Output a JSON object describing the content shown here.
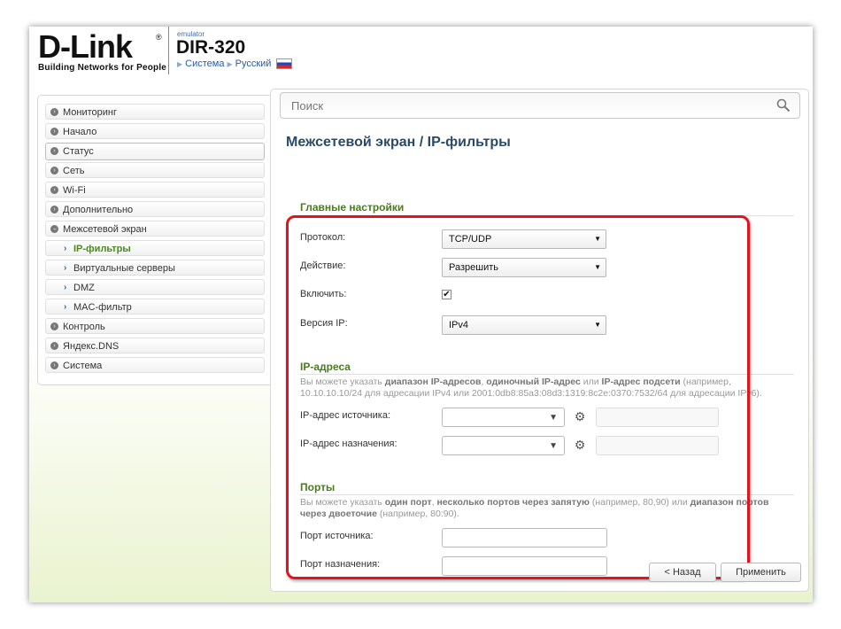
{
  "header": {
    "logo_text": "D-Link",
    "logo_reg": "®",
    "logo_sub": "Building Networks for People",
    "emulator_label": "emulator",
    "model": "DIR-320",
    "crumb_system": "Система",
    "crumb_language": "Русский"
  },
  "sidebar": {
    "items": [
      {
        "label": "Мониторинг"
      },
      {
        "label": "Начало"
      },
      {
        "label": "Статус"
      },
      {
        "label": "Сеть"
      },
      {
        "label": "Wi-Fi"
      },
      {
        "label": "Дополнительно"
      },
      {
        "label": "Межсетевой экран"
      },
      {
        "label": "IP-фильтры"
      },
      {
        "label": "Виртуальные серверы"
      },
      {
        "label": "DMZ"
      },
      {
        "label": "MAC-фильтр"
      },
      {
        "label": "Контроль"
      },
      {
        "label": "Яндекс.DNS"
      },
      {
        "label": "Система"
      }
    ]
  },
  "search": {
    "placeholder": "Поиск"
  },
  "page_title": "Межсетевой экран /  IP-фильтры",
  "main_settings": {
    "title": "Главные настройки",
    "protocol_label": "Протокол:",
    "protocol_value": "TCP/UDP",
    "action_label": "Действие:",
    "action_value": "Разрешить",
    "enable_label": "Включить:",
    "enable_checked": true,
    "ip_version_label": "Версия IP:",
    "ip_version_value": "IPv4"
  },
  "ip_section": {
    "title": "IP-адреса",
    "hint_1": "Вы можете указать ",
    "hint_b1": "диапазон IP-адресов",
    "hint_2": ", ",
    "hint_b2": "одиночный IP-адрес",
    "hint_3": " или ",
    "hint_b3": "IP-адрес подсети",
    "hint_4": " (например, 10.10.10.10/24 для адресации IPv4 или 2001:0db8:85a3:08d3:1319:8c2e:0370:7532/64 для адресации IPv6).",
    "source_label": "IP-адрес источника:",
    "dest_label": "IP-адрес назначения:"
  },
  "ports_section": {
    "title": "Порты",
    "hint_1": "Вы можете указать ",
    "hint_b1": "один порт",
    "hint_2": ", ",
    "hint_b2": "несколько портов через запятую",
    "hint_3": " (например, 80,90) или ",
    "hint_b3": "диапазон портов через двоеточие",
    "hint_4": " (например, 80:90).",
    "source_label": "Порт источника:",
    "dest_label": "Порт назначения:"
  },
  "buttons": {
    "back": "< Назад",
    "apply": "Применить"
  },
  "colors": {
    "highlight_red": "#e0141e",
    "section_green": "#4a7a22",
    "link_blue": "#2a5ba8"
  }
}
